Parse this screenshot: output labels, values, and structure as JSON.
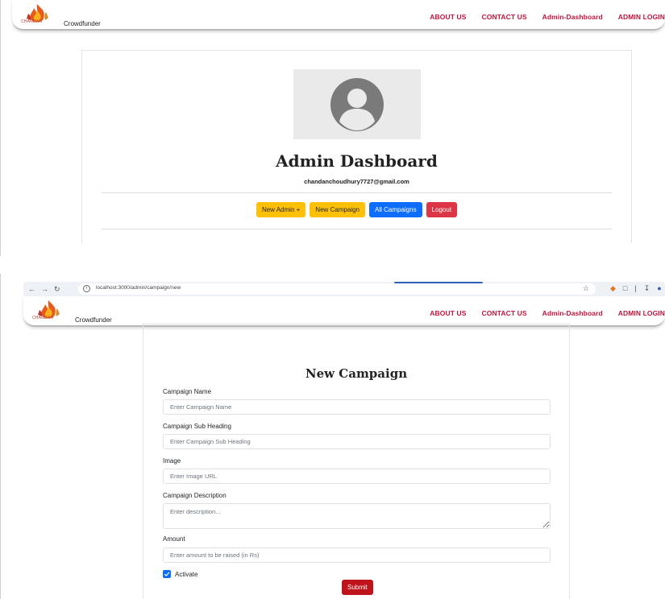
{
  "top": {
    "nav": {
      "brand": "Crowdfunder",
      "logo_text": "CHANDAN",
      "links": [
        "ABOUT US",
        "CONTACT US",
        "Admin-Dashboard",
        "ADMIN LOGIN"
      ]
    },
    "dashboard": {
      "title": "Admin Dashboard",
      "email": "chandanchoudhury7727@gmail.com",
      "buttons": {
        "new_admin": "New Admin +",
        "new_campaign": "New Campaign",
        "all_campaigns": "All Campaigns",
        "logout": "Logout"
      }
    }
  },
  "bottom": {
    "browser": {
      "url": "localhost:3000/admin/campaign/new"
    },
    "nav": {
      "brand": "Crowdfunder",
      "logo_text": "CHANDAN",
      "links": [
        "ABOUT US",
        "CONTACT US",
        "Admin-Dashboard",
        "ADMIN LOGIN"
      ]
    },
    "form": {
      "title": "New Campaign",
      "fields": [
        {
          "label": "Campaign Name",
          "placeholder": "Enter Campaign Name"
        },
        {
          "label": "Campaign Sub Heading",
          "placeholder": "Enter Campaign Sub Heading"
        },
        {
          "label": "Image",
          "placeholder": "Enter Image URL"
        },
        {
          "label": "Campaign Description",
          "placeholder": "Enter description..."
        },
        {
          "label": "Amount",
          "placeholder": "Enter amount to be raised (in Rs)"
        }
      ],
      "activate_label": "Activate",
      "activate_checked": true,
      "submit_label": "Submit"
    }
  },
  "colors": {
    "nav_link": "#c0143c",
    "btn_yellow": "#ffc107",
    "btn_blue": "#0d6efd",
    "btn_red": "#dc3545",
    "submit": "#c0141c"
  }
}
